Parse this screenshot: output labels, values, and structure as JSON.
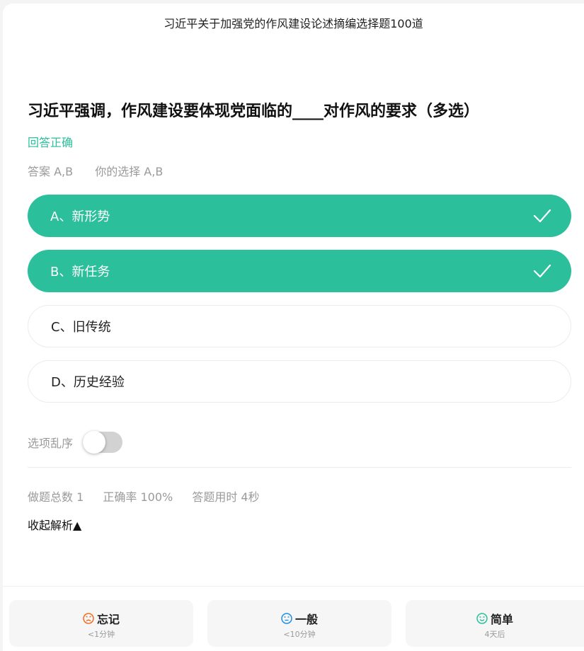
{
  "header": {
    "title": "习近平关于加强党的作风建设论述摘编选择题100道"
  },
  "question": {
    "text": "习近平强调，作风建设要体现党面临的____对作风的要求（多选）",
    "result": "回答正确",
    "answer": "答案 A,B",
    "your_choice": "你的选择 A,B"
  },
  "options": [
    {
      "label": "A、新形势",
      "state": "correct"
    },
    {
      "label": "B、新任务",
      "state": "correct"
    },
    {
      "label": "C、旧传统",
      "state": "none"
    },
    {
      "label": "D、历史经验",
      "state": "none"
    }
  ],
  "shuffle": {
    "label": "选项乱序",
    "enabled": false
  },
  "stats": {
    "total": "做题总数 1",
    "accuracy": "正确率 100%",
    "time": "答题用时 4秒"
  },
  "analysis": {
    "collapse_label": "收起解析▲"
  },
  "rating": [
    {
      "title": "忘记",
      "sub": "<1分钟",
      "icon": "sad-face-icon",
      "color": "#f26b1d"
    },
    {
      "title": "一般",
      "sub": "<10分钟",
      "icon": "neutral-face-icon",
      "color": "#1e90e6"
    },
    {
      "title": "简单",
      "sub": "4天后",
      "icon": "happy-face-icon",
      "color": "#2bbf9b"
    }
  ],
  "colors": {
    "accent": "#2bbf9b"
  }
}
